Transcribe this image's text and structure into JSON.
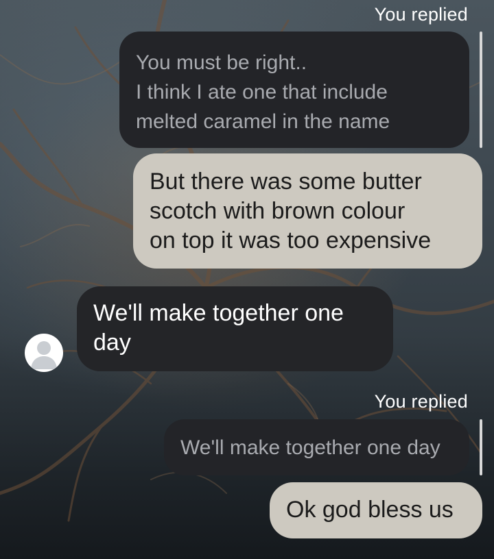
{
  "conversation": {
    "reply_label_1": "You replied",
    "quoted_1": {
      "lines": [
        "You must be right..",
        "I think I ate one that include",
        "melted caramel in the name"
      ]
    },
    "sent_1": {
      "lines": [
        "But there was some butter",
        "scotch with brown colour",
        "on top it was too expensive"
      ]
    },
    "received_1": {
      "lines": [
        "We'll make together one",
        "day"
      ]
    },
    "reply_label_2": "You replied",
    "quoted_2": {
      "lines": [
        "We'll make together one day"
      ]
    },
    "sent_2": {
      "lines": [
        "Ok god bless us"
      ]
    }
  },
  "icons": {
    "contact_avatar": "default-person-avatar-icon"
  },
  "colors": {
    "sent_bubble": "#cdc9c0",
    "received_bubble": "#242528",
    "quoted_bubble": "#232428",
    "quoted_text": "#a9abb0"
  }
}
